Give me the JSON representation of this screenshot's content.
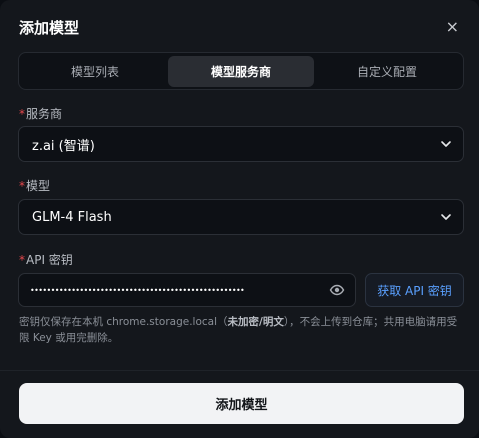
{
  "dialog": {
    "title": "添加模型",
    "close_glyph": "×"
  },
  "tabs": [
    {
      "label": "模型列表",
      "active": false
    },
    {
      "label": "模型服务商",
      "active": true
    },
    {
      "label": "自定义配置",
      "active": false
    }
  ],
  "provider": {
    "required_mark": "*",
    "label": "服务商",
    "value": "z.ai (智谱)"
  },
  "model": {
    "required_mark": "*",
    "label": "模型",
    "value": "GLM-4 Flash"
  },
  "api_key": {
    "required_mark": "*",
    "label": "API 密钥",
    "masked_value": "••••••••••••••••••••••••••••••••••••••••••••••••••••",
    "get_key_label": "获取 API 密钥"
  },
  "hint": {
    "prefix": "密钥仅保存在本机 chrome.storage.local（",
    "emphasis": "未加密/明文",
    "suffix": "），不会上传到仓库；共用电脑请用受限 Key 或用完删除。"
  },
  "footer": {
    "submit_label": "添加模型"
  },
  "icons": {
    "close": "close-icon",
    "chevron": "chevron-down-icon",
    "eye": "eye-icon"
  },
  "colors": {
    "accent_link": "#5aa0ff",
    "required": "#e5484d",
    "primary_button": "#f2f3f5"
  }
}
